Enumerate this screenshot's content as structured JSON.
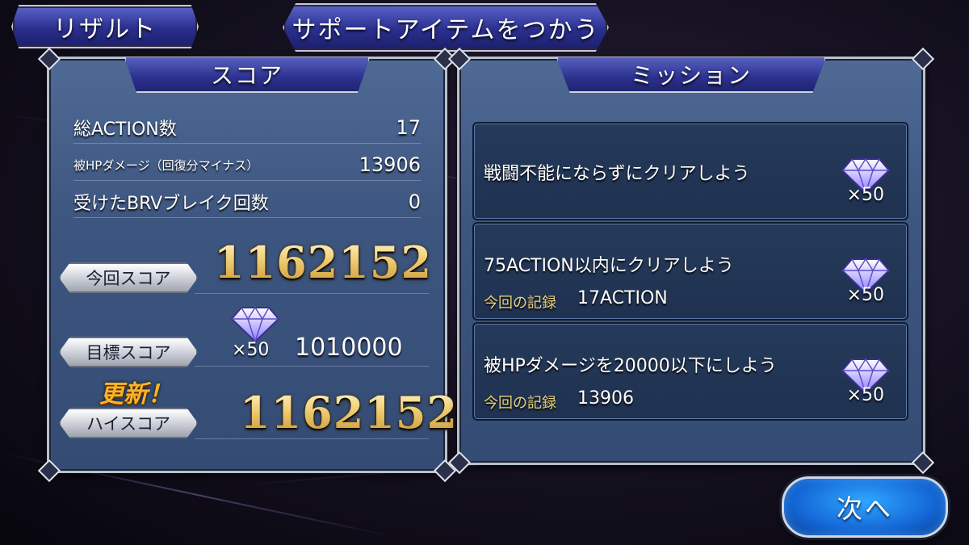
{
  "tabs": {
    "result_label": "リザルト",
    "support_label": "サポートアイテムをつかう"
  },
  "score_panel": {
    "header": "スコア",
    "rows": [
      {
        "label": "総ACTION数",
        "value": "17"
      },
      {
        "label": "被HPダメージ（回復分マイナス）",
        "value": "13906"
      },
      {
        "label": "受けたBRVブレイク回数",
        "value": "0"
      }
    ],
    "current_score_label": "今回スコア",
    "current_score": "1162152",
    "target_score_label": "目標スコア",
    "target_reward": "×50",
    "target_score": "1010000",
    "updated_label": "更新！",
    "high_score_label": "ハイスコア",
    "high_score": "1162152"
  },
  "mission_panel": {
    "header": "ミッション",
    "missions": [
      {
        "title": "戦闘不能にならずにクリアしよう",
        "record_label": "",
        "record_value": "",
        "reward": "×50"
      },
      {
        "title": "75ACTION以内にクリアしよう",
        "record_label": "今回の記録",
        "record_value": "17ACTION",
        "reward": "×50"
      },
      {
        "title": "被HPダメージを20000以下にしよう",
        "record_label": "今回の記録",
        "record_value": "13906",
        "reward": "×50"
      }
    ]
  },
  "next_button_label": "次へ",
  "icons": {
    "reward": "diamond-gem-icon"
  }
}
